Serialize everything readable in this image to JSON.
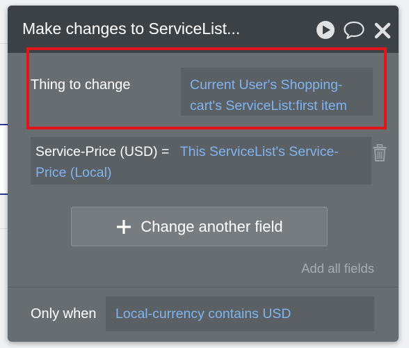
{
  "dialog": {
    "title": "Make changes to ServiceList...",
    "icons": [
      "play-icon",
      "comment-icon",
      "close-icon"
    ]
  },
  "thing_to_change": {
    "label": "Thing to change",
    "value": "Current User's Shopping-cart's ServiceList:first item",
    "highlight_color": "#e0161b"
  },
  "field_change": {
    "field": "Service-Price (USD)",
    "operator": " = ",
    "value": "This ServiceList's Service-Price (Local)",
    "icon": "trash-icon"
  },
  "actions": {
    "change_another_field": "Change another field",
    "add_all_fields": "Add all fields"
  },
  "condition": {
    "label": "Only when",
    "value": "Local-currency contains USD"
  },
  "colors": {
    "header_bg": "#3c4145",
    "panel_bg": "#686d72",
    "link_blue": "#7fb4f0"
  }
}
